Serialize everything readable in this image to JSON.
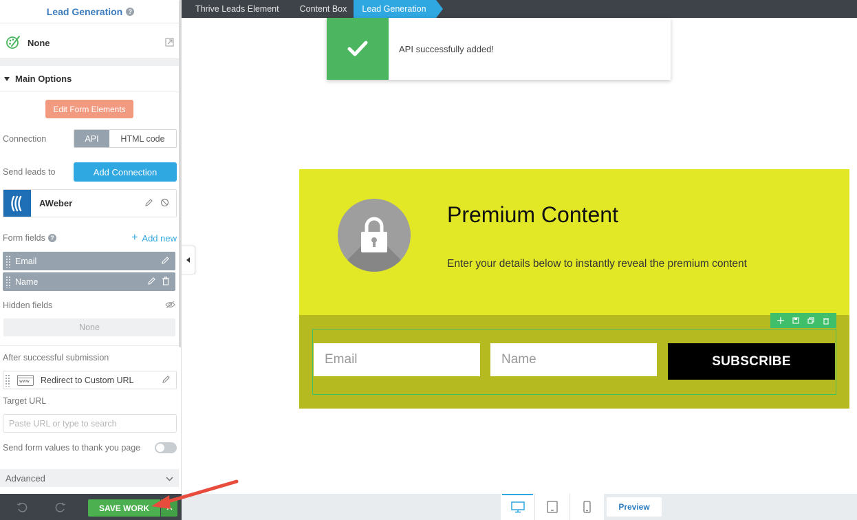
{
  "sidebar": {
    "title": "Lead Generation",
    "style_selector": "None",
    "section_title": "Main Options",
    "edit_form_label": "Edit Form Elements",
    "connection_label": "Connection",
    "connection_options": [
      "API",
      "HTML code"
    ],
    "send_leads_label": "Send leads to",
    "add_connection_label": "Add Connection",
    "connected_service": "AWeber",
    "form_fields_label": "Form fields",
    "add_new_label": "Add new",
    "form_fields": [
      "Email",
      "Name"
    ],
    "hidden_fields_label": "Hidden fields",
    "hidden_fields_value": "None",
    "after_submission_label": "After successful submission",
    "after_submission_action": "Redirect to Custom URL",
    "target_url_label": "Target URL",
    "target_url_placeholder": "Paste URL or type to search",
    "send_values_label": "Send form values to thank you page",
    "advanced_label": "Advanced"
  },
  "breadcrumb": [
    "Thrive Leads Element",
    "Content Box",
    "Lead Generation"
  ],
  "notification": {
    "message": "API successfully added!"
  },
  "content": {
    "title": "Premium Content",
    "subtitle": "Enter your details below to instantly reveal the premium content",
    "email_placeholder": "Email",
    "name_placeholder": "Name",
    "subscribe_label": "SUBSCRIBE"
  },
  "bottom_bar": {
    "save_label": "SAVE WORK",
    "preview_label": "Preview"
  },
  "colors": {
    "accent": "#2fa7e0",
    "success": "#4cb560",
    "save": "#4caf50",
    "content_bg": "#e2e826",
    "content_bottom": "#b4ba1f",
    "edit_button": "#f29a80"
  }
}
